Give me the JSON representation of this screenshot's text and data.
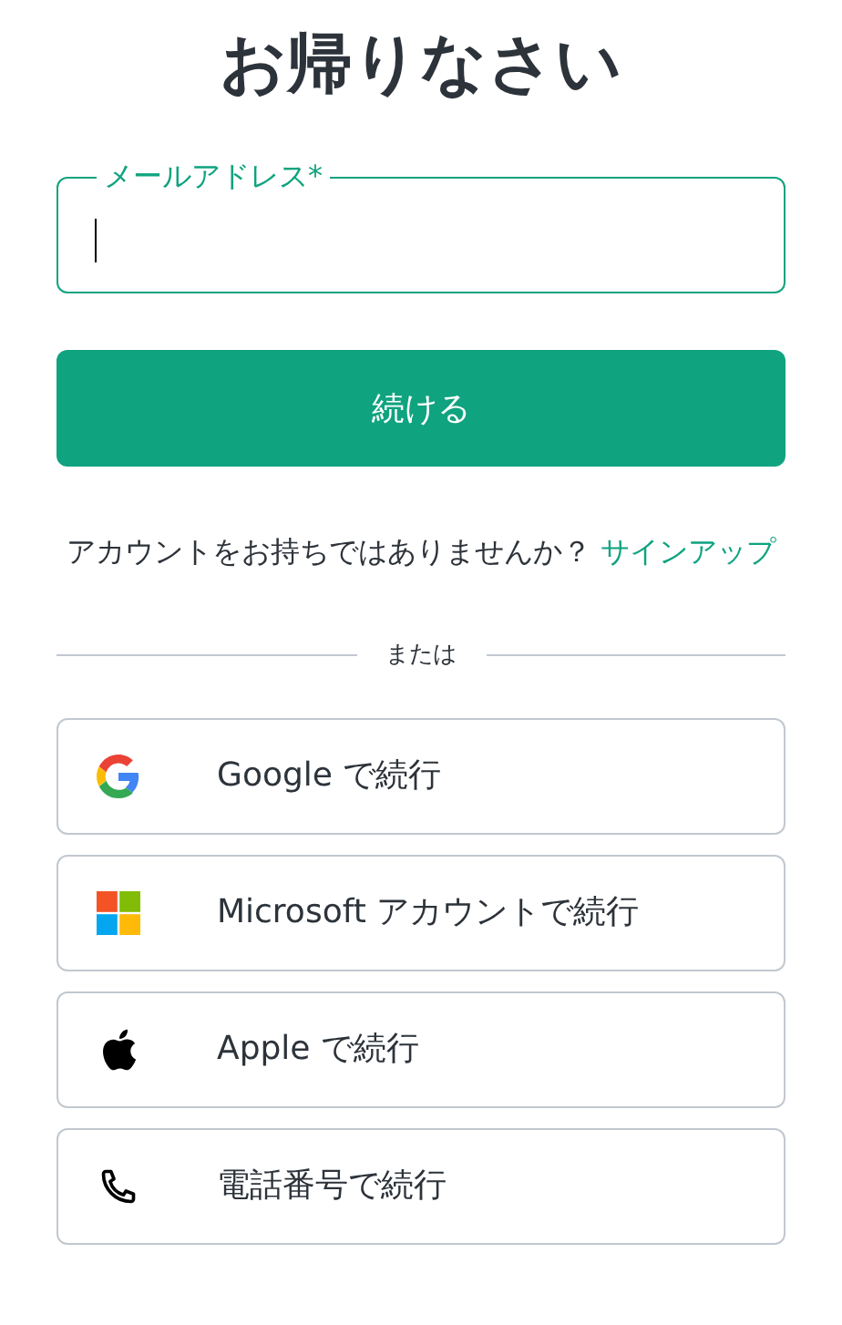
{
  "title": "お帰りなさい",
  "email_field": {
    "label": "メールアドレス*",
    "focused": true
  },
  "continue_button": "続ける",
  "signup_prompt": {
    "text": "アカウントをお持ちではありませんか？",
    "link": "サインアップ"
  },
  "divider_text": "または",
  "providers": [
    {
      "kind": "google",
      "label": "Google で続行"
    },
    {
      "kind": "microsoft",
      "label": "Microsoft アカウントで続行"
    },
    {
      "kind": "apple",
      "label": "Apple で続行"
    },
    {
      "kind": "phone",
      "label": "電話番号で続行"
    }
  ]
}
